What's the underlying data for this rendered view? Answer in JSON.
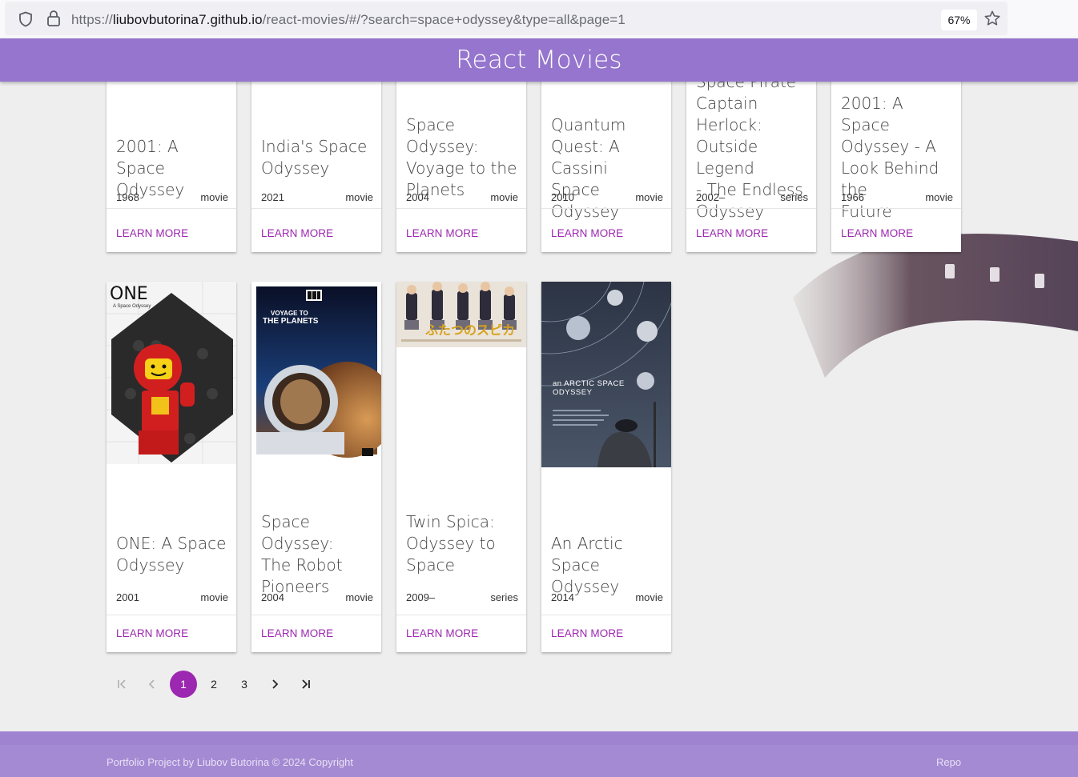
{
  "browser": {
    "url_prefix": "https://",
    "url_host": "liubovbutorina7.github.io",
    "url_path": "/react-movies/#/?search=space+odyssey&type=all&page=1",
    "zoom": "67%"
  },
  "header": {
    "title": "React Movies"
  },
  "cards_row1": [
    {
      "title_lines": [
        "2001: A Space",
        "Odyssey"
      ],
      "year": "1968",
      "type": "movie",
      "link": "LEARN MORE"
    },
    {
      "title_lines": [
        "India's Space",
        "Odyssey"
      ],
      "year": "2021",
      "type": "movie",
      "link": "LEARN MORE"
    },
    {
      "title_lines": [
        "Space Odyssey:",
        "Voyage to the",
        "Planets"
      ],
      "year": "2004",
      "type": "movie",
      "link": "LEARN MORE"
    },
    {
      "title_lines": [
        "Quantum",
        "Quest: A Cassini",
        "Space Odyssey"
      ],
      "year": "2010",
      "type": "movie",
      "link": "LEARN MORE"
    },
    {
      "title_lines": [
        "Space Pirate",
        "Captain Herlock:",
        "Outside Legend",
        "- The Endless",
        "Odyssey"
      ],
      "year": "2002–",
      "type": "series",
      "link": "LEARN MORE"
    },
    {
      "title_lines": [
        "2001: A Space",
        "Odyssey - A",
        "Look Behind the",
        "Future"
      ],
      "year": "1966",
      "type": "movie",
      "link": "LEARN MORE"
    }
  ],
  "cards_row2": [
    {
      "title_lines": [
        "ONE: A Space",
        "Odyssey"
      ],
      "year": "2001",
      "type": "movie",
      "link": "LEARN MORE",
      "poster_text": "ONE",
      "poster_sub": "A Space Odyssey"
    },
    {
      "title_lines": [
        "Space Odyssey:",
        "The Robot",
        "Pioneers"
      ],
      "year": "2004",
      "type": "movie",
      "link": "LEARN MORE",
      "poster_text": "VOYAGE TO",
      "poster_sub": "THE PLANETS"
    },
    {
      "title_lines": [
        "Twin Spica:",
        "Odyssey to",
        "Space"
      ],
      "year": "2009–",
      "type": "series",
      "link": "LEARN MORE",
      "poster_text": "ふたつのスピカ"
    },
    {
      "title_lines": [
        "An Arctic Space",
        "Odyssey"
      ],
      "year": "2014",
      "type": "movie",
      "link": "LEARN MORE",
      "poster_text": "an ARCTIC SPACE",
      "poster_sub": "ODYSSEY"
    }
  ],
  "pagination": {
    "pages": [
      "1",
      "2",
      "3"
    ],
    "current": "1"
  },
  "footer": {
    "copyright": "Portfolio Project by Liubov Butorina © 2024 Copyright",
    "repo": "Repo"
  },
  "colors": {
    "header": "#9575cd",
    "accent": "#9c27b0",
    "footer": "#a48ad2"
  }
}
